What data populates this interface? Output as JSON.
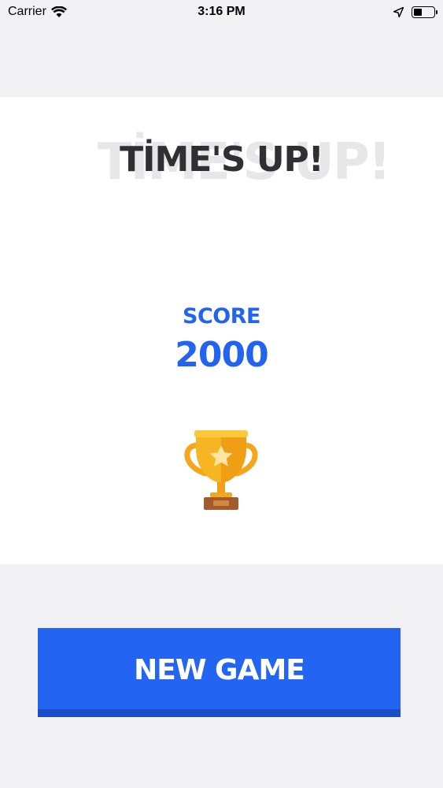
{
  "status_bar": {
    "carrier": "Carrier",
    "time": "3:16 PM"
  },
  "game_over": {
    "title": "TİME'S UP!",
    "title_ghost": "TİME'S UP!",
    "score_label": "SCORE",
    "score_value": "2000"
  },
  "actions": {
    "new_game_label": "NEW GAME"
  },
  "colors": {
    "accent_blue": "#2364f2",
    "title_dark": "#2f2f34",
    "trophy_gold": "#f6b21f",
    "background": "#f2f2f4"
  },
  "icons": [
    "wifi-icon",
    "location-arrow-icon",
    "battery-icon",
    "trophy-icon"
  ]
}
